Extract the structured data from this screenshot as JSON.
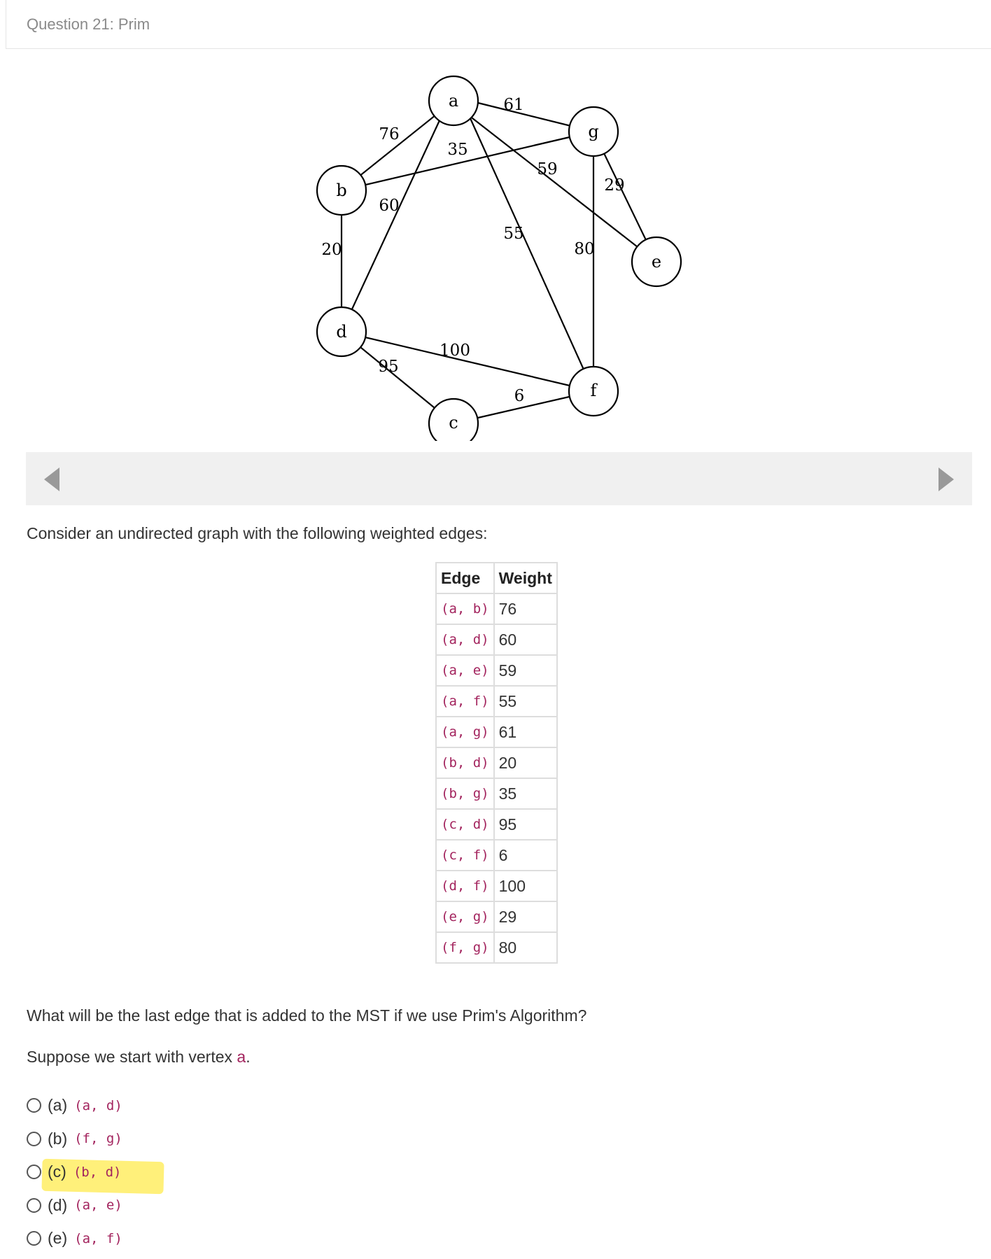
{
  "header": {
    "title": "Question 21: Prim"
  },
  "graph": {
    "nodes": [
      {
        "id": "a",
        "label": "a"
      },
      {
        "id": "b",
        "label": "b"
      },
      {
        "id": "c",
        "label": "c"
      },
      {
        "id": "d",
        "label": "d"
      },
      {
        "id": "e",
        "label": "e"
      },
      {
        "id": "f",
        "label": "f"
      },
      {
        "id": "g",
        "label": "g"
      }
    ],
    "edge_labels": [
      "76",
      "35",
      "61",
      "59",
      "29",
      "60",
      "55",
      "80",
      "20",
      "100",
      "95",
      "6"
    ]
  },
  "intro_text": "Consider an undirected graph with the following weighted edges:",
  "table": {
    "headers": {
      "edge": "Edge",
      "weight": "Weight"
    },
    "rows": [
      {
        "edge": "(a, b)",
        "weight": "76"
      },
      {
        "edge": "(a, d)",
        "weight": "60"
      },
      {
        "edge": "(a, e)",
        "weight": "59"
      },
      {
        "edge": "(a, f)",
        "weight": "55"
      },
      {
        "edge": "(a, g)",
        "weight": "61"
      },
      {
        "edge": "(b, d)",
        "weight": "20"
      },
      {
        "edge": "(b, g)",
        "weight": "35"
      },
      {
        "edge": "(c, d)",
        "weight": "95"
      },
      {
        "edge": "(c, f)",
        "weight": "6"
      },
      {
        "edge": "(d, f)",
        "weight": "100"
      },
      {
        "edge": "(e, g)",
        "weight": "29"
      },
      {
        "edge": "(f, g)",
        "weight": "80"
      }
    ]
  },
  "question_text": "What will be the last edge that is added to the MST if we use Prim's Algorithm?",
  "start": {
    "prefix": "Suppose we start with vertex ",
    "vertex": "a",
    "suffix": "."
  },
  "options": [
    {
      "letter": "(a)",
      "value": "(a, d)"
    },
    {
      "letter": "(b)",
      "value": "(f, g)"
    },
    {
      "letter": "(c)",
      "value": "(b, d)"
    },
    {
      "letter": "(d)",
      "value": "(a, e)"
    },
    {
      "letter": "(e)",
      "value": "(a, f)"
    }
  ],
  "colors": {
    "code": "#a3245e",
    "highlight": "#fff07a",
    "carousel_bg": "#f0f0f0"
  },
  "icons": {
    "prev": "triangle-left-icon",
    "next": "triangle-right-icon"
  }
}
